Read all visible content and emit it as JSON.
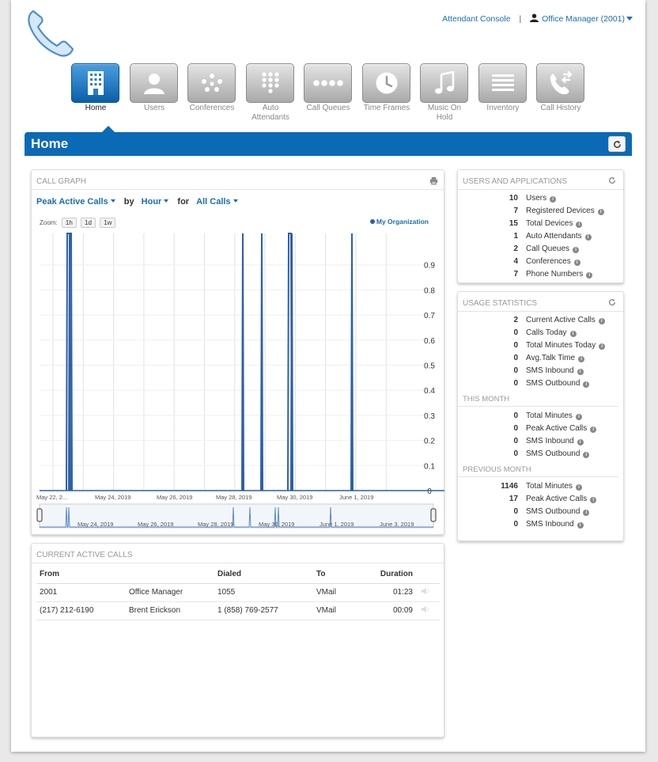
{
  "header": {
    "attendant_console": "Attendant Console",
    "separator": "|",
    "user_menu": "Office Manager (2001)"
  },
  "nav": [
    {
      "label": "Home",
      "icon": "building-icon",
      "active": true
    },
    {
      "label": "Users",
      "icon": "user-icon"
    },
    {
      "label": "Conferences",
      "icon": "conference-icon"
    },
    {
      "label": "Auto Attendants",
      "icon": "keypad-icon"
    },
    {
      "label": "Call Queues",
      "icon": "queue-dots-icon"
    },
    {
      "label": "Time Frames",
      "icon": "clock-icon"
    },
    {
      "label": "Music On Hold",
      "icon": "music-note-icon"
    },
    {
      "label": "Inventory",
      "icon": "list-icon"
    },
    {
      "label": "Call History",
      "icon": "phone-history-icon"
    }
  ],
  "page_title": "Home",
  "call_graph": {
    "title": "CALL GRAPH",
    "metric": "Peak Active Calls",
    "by_label": "by",
    "interval": "Hour",
    "for_label": "for",
    "filter": "All Calls",
    "zoom_label": "Zoom:",
    "zoom_options": [
      "1h",
      "1d",
      "1w"
    ],
    "legend": "My Organization"
  },
  "chart_data": {
    "type": "line",
    "series": [
      {
        "name": "My Organization",
        "color": "#2e5fa8"
      }
    ],
    "y_ticks": [
      "0.9",
      "0.8",
      "0.7",
      "0.6",
      "0.5",
      "0.4",
      "0.3",
      "0.2",
      "0.1",
      "0"
    ],
    "ylim": [
      0,
      1
    ],
    "x_labels": [
      "May 22, 2...",
      "May 24, 2019",
      "May 26, 2019",
      "May 28, 2019",
      "May 30, 2019",
      "June 1, 2019"
    ],
    "navigator_labels": [
      "May 24, 2019",
      "May 26, 2019",
      "May 28, 2019",
      "May 30, 2019",
      "June 1, 2019",
      "June 3, 2019"
    ],
    "spike_dates": [
      "May 22, 2019",
      "May 22, 2019",
      "May 28, 2019",
      "May 29, 2019",
      "May 30, 2019",
      "May 30, 2019",
      "June 1, 2019"
    ],
    "spike_value": 1
  },
  "users_apps": {
    "title": "USERS AND APPLICATIONS",
    "rows": [
      {
        "value": "10",
        "label": "Users"
      },
      {
        "value": "7",
        "label": "Registered Devices"
      },
      {
        "value": "15",
        "label": "Total Devices"
      },
      {
        "value": "1",
        "label": "Auto Attendants"
      },
      {
        "value": "2",
        "label": "Call Queues"
      },
      {
        "value": "4",
        "label": "Conferences"
      },
      {
        "value": "7",
        "label": "Phone Numbers"
      }
    ]
  },
  "usage": {
    "title": "USAGE STATISTICS",
    "rows": [
      {
        "value": "2",
        "label": "Current Active Calls"
      },
      {
        "value": "0",
        "label": "Calls Today"
      },
      {
        "value": "0",
        "label": "Total Minutes Today"
      },
      {
        "value": "0",
        "label": "Avg.Talk Time"
      },
      {
        "value": "0",
        "label": "SMS Inbound"
      },
      {
        "value": "0",
        "label": "SMS Outbound"
      }
    ],
    "this_month_title": "THIS MONTH",
    "this_month": [
      {
        "value": "0",
        "label": "Total Minutes"
      },
      {
        "value": "0",
        "label": "Peak Active Calls"
      },
      {
        "value": "0",
        "label": "SMS Inbound"
      },
      {
        "value": "0",
        "label": "SMS Outbound"
      }
    ],
    "prev_month_title": "PREVIOUS MONTH",
    "prev_month": [
      {
        "value": "1146",
        "label": "Total Minutes"
      },
      {
        "value": "17",
        "label": "Peak Active Calls"
      },
      {
        "value": "0",
        "label": "SMS Outbound"
      },
      {
        "value": "0",
        "label": "SMS Inbound"
      }
    ]
  },
  "active_calls": {
    "title": "CURRENT ACTIVE CALLS",
    "headers": {
      "from": "From",
      "name": "",
      "dialed": "Dialed",
      "to": "To",
      "duration": "Duration"
    },
    "rows": [
      {
        "from": "2001",
        "name": "Office Manager",
        "dialed": "1055",
        "to": "VMail",
        "duration": "01:23"
      },
      {
        "from": "(217) 212-6190",
        "name": "Brent Erickson",
        "dialed": "1 (858) 769-2577",
        "to": "VMail",
        "duration": "00:09"
      }
    ]
  }
}
